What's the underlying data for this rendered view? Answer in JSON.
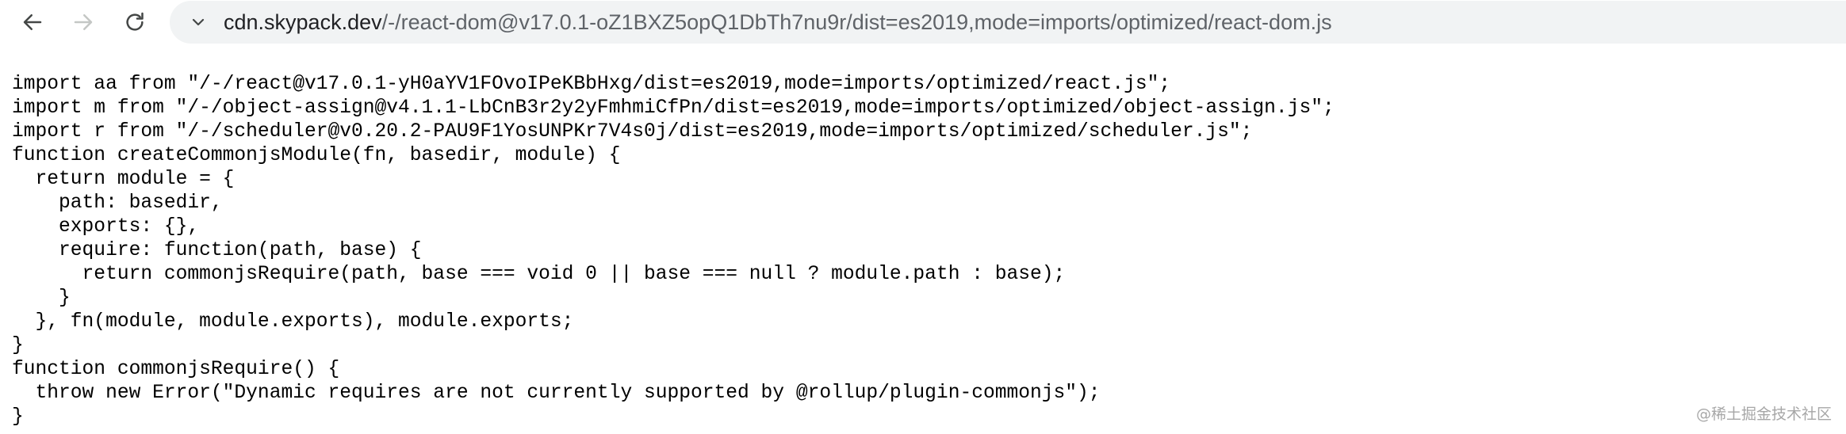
{
  "browser": {
    "url_host": "cdn.skypack.dev",
    "url_path": "/-/react-dom@v17.0.1-oZ1BXZ5opQ1DbTh7nu9r/dist=es2019,mode=imports/optimized/react-dom.js",
    "icons": {
      "back": "arrow-left-icon",
      "forward": "arrow-right-icon",
      "reload": "reload-icon",
      "omnibox": "chevron-down-icon"
    },
    "colors": {
      "omnibox_bg": "#f1f3f4",
      "forward_disabled": "#c4c7c5"
    }
  },
  "code_lines": [
    "import aa from \"/-/react@v17.0.1-yH0aYV1FOvoIPeKBbHxg/dist=es2019,mode=imports/optimized/react.js\";",
    "import m from \"/-/object-assign@v4.1.1-LbCnB3r2y2yFmhmiCfPn/dist=es2019,mode=imports/optimized/object-assign.js\";",
    "import r from \"/-/scheduler@v0.20.2-PAU9F1YosUNPKr7V4s0j/dist=es2019,mode=imports/optimized/scheduler.js\";",
    "function createCommonjsModule(fn, basedir, module) {",
    "  return module = {",
    "    path: basedir,",
    "    exports: {},",
    "    require: function(path, base) {",
    "      return commonjsRequire(path, base === void 0 || base === null ? module.path : base);",
    "    }",
    "  }, fn(module, module.exports), module.exports;",
    "}",
    "function commonjsRequire() {",
    "  throw new Error(\"Dynamic requires are not currently supported by @rollup/plugin-commonjs\");",
    "}"
  ],
  "watermark": "@稀土掘金技术社区"
}
